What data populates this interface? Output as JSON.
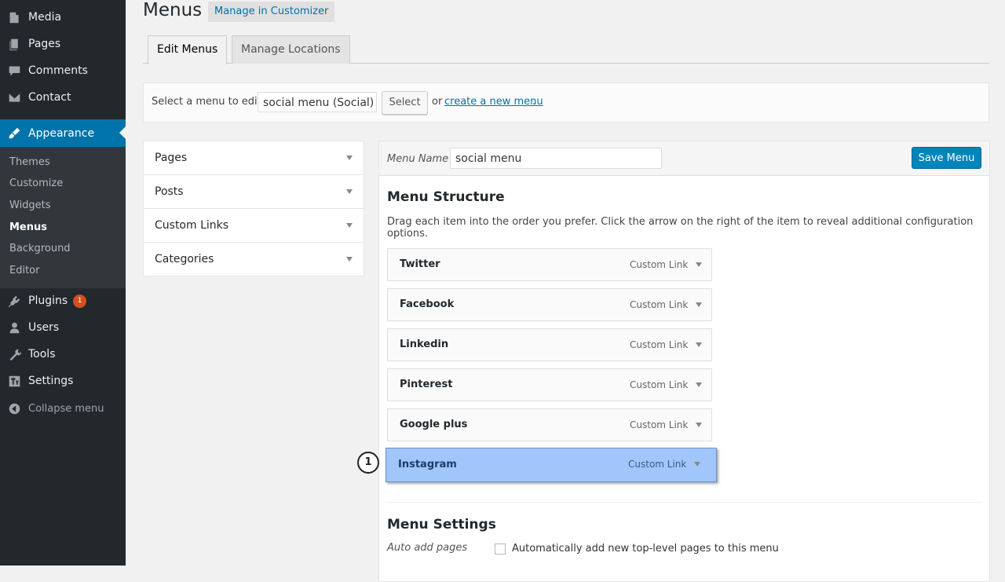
{
  "sidebar": {
    "items": [
      {
        "label": "Media",
        "icon": "media-icon"
      },
      {
        "label": "Pages",
        "icon": "pages-icon"
      },
      {
        "label": "Comments",
        "icon": "comments-icon"
      },
      {
        "label": "Contact",
        "icon": "mail-icon"
      },
      {
        "label": "Appearance",
        "icon": "appearance-icon",
        "active": true
      },
      {
        "label": "Plugins",
        "icon": "plugins-icon",
        "badge": "1"
      },
      {
        "label": "Users",
        "icon": "users-icon"
      },
      {
        "label": "Tools",
        "icon": "tools-icon"
      },
      {
        "label": "Settings",
        "icon": "settings-icon"
      }
    ],
    "submenu": [
      "Themes",
      "Customize",
      "Widgets",
      "Menus",
      "Background",
      "Editor"
    ],
    "current_submenu": "Menus",
    "collapse_label": "Collapse menu",
    "accent_color": "#0073aa"
  },
  "header": {
    "title": "Menus",
    "customizer_link": "Manage in Customizer"
  },
  "tabs": [
    {
      "label": "Edit Menus",
      "active": true
    },
    {
      "label": "Manage Locations",
      "active": false
    }
  ],
  "select_bar": {
    "label": "Select a menu to edit:",
    "selected_menu": "social menu (Social)",
    "select_button": "Select",
    "or_text": "or",
    "create_link": "create a new menu",
    "trailing": "."
  },
  "accordion": [
    {
      "label": "Pages"
    },
    {
      "label": "Posts"
    },
    {
      "label": "Custom Links"
    },
    {
      "label": "Categories"
    }
  ],
  "editor": {
    "menu_name_label": "Menu Name",
    "menu_name_value": "social menu",
    "save_button": "Save Menu",
    "structure_title": "Menu Structure",
    "structure_desc": "Drag each item into the order you prefer. Click the arrow on the right of the item to reveal additional configuration options.",
    "items": [
      {
        "title": "Twitter",
        "type": "Custom Link"
      },
      {
        "title": "Facebook",
        "type": "Custom Link"
      },
      {
        "title": "Linkedin",
        "type": "Custom Link"
      },
      {
        "title": "Pinterest",
        "type": "Custom Link"
      },
      {
        "title": "Google plus",
        "type": "Custom Link"
      },
      {
        "title": "Instagram",
        "type": "Custom Link",
        "highlighted": true
      }
    ],
    "step_marker": "1",
    "settings_title": "Menu Settings",
    "auto_add_label": "Auto add pages",
    "auto_add_text": "Automatically add new top-level pages to this menu",
    "auto_add_checked": false
  }
}
